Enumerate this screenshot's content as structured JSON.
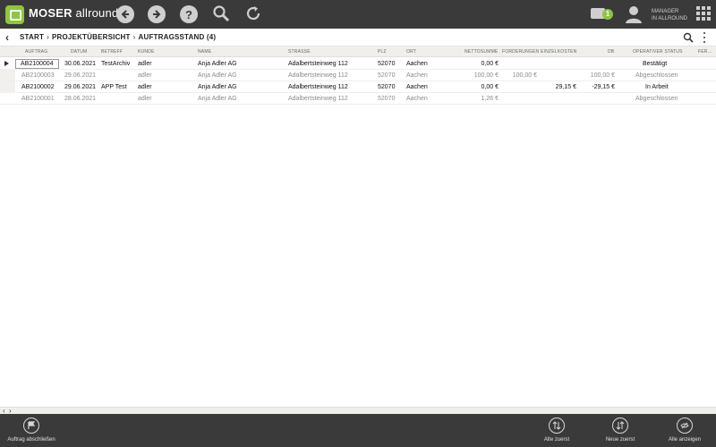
{
  "app": {
    "brand": "MOSER",
    "brand_suffix": "allround",
    "help_glyph": "?",
    "notification_count": "1",
    "user_line1": "MANAGER",
    "user_line2": "IN ALLROUND"
  },
  "breadcrumb": {
    "back_glyph": "‹",
    "items": [
      "START",
      "PROJEKTÜBERSICHT",
      "AUFTRAGSSTAND (4)"
    ],
    "separator": "›"
  },
  "table": {
    "headers": {
      "auftrag": "AUFTRAG",
      "datum": "DATUM",
      "betreff": "BETREFF",
      "kunde": "KUNDE",
      "name": "NAME",
      "strasse": "STRASSE",
      "plz": "PLZ",
      "ort": "ORT",
      "nettosumme": "NETTOSUMME",
      "forderungen": "FORDERUNGEN",
      "einzelkosten": "EINZELKOSTEN",
      "db": "DB",
      "status": "OPERATIVER STATUS",
      "fer": "FER..."
    },
    "rows": [
      {
        "auftrag": "AB2100004",
        "datum": "30.06.2021",
        "betreff": "TestArchiv",
        "kunde": "adler",
        "name": "Anja Adler AG",
        "strasse": "Adalbertsteinweg 112",
        "plz": "52070",
        "ort": "Aachen",
        "nettosumme": "0,00 €",
        "forderungen": "",
        "einzelkosten": "",
        "db": "",
        "status": "Bestätigt"
      },
      {
        "auftrag": "AB2100003",
        "datum": "29.06.2021",
        "betreff": "",
        "kunde": "adler",
        "name": "Anja Adler AG",
        "strasse": "Adalbertsteinweg 112",
        "plz": "52070",
        "ort": "Aachen",
        "nettosumme": "100,00 €",
        "forderungen": "100,00 €",
        "einzelkosten": "",
        "db": "100,00 €",
        "status": "Abgeschlossen"
      },
      {
        "auftrag": "AB2100002",
        "datum": "29.06.2021",
        "betreff": "APP Test",
        "kunde": "adler",
        "name": "Anja Adler AG",
        "strasse": "Adalbertsteinweg 112",
        "plz": "52070",
        "ort": "Aachen",
        "nettosumme": "0,00 €",
        "forderungen": "",
        "einzelkosten": "29,15 €",
        "db": "-29,15 €",
        "status": "In Arbeit"
      },
      {
        "auftrag": "AB2100001",
        "datum": "28.06.2021",
        "betreff": "",
        "kunde": "adler",
        "name": "Anja Adler AG",
        "strasse": "Adalbertsteinweg 112",
        "plz": "52070",
        "ort": "Aachen",
        "nettosumme": "1,26 €",
        "forderungen": "",
        "einzelkosten": "",
        "db": "",
        "status": "Abgeschlossen"
      }
    ]
  },
  "scroll": {
    "left_glyph": "‹",
    "right_glyph": "›"
  },
  "bottombar": {
    "close_order": "Auftrag abschließen",
    "oldest_first": "Alte zuerst",
    "newest_first": "Neue zuerst",
    "show_all": "Alle anzeigen"
  }
}
